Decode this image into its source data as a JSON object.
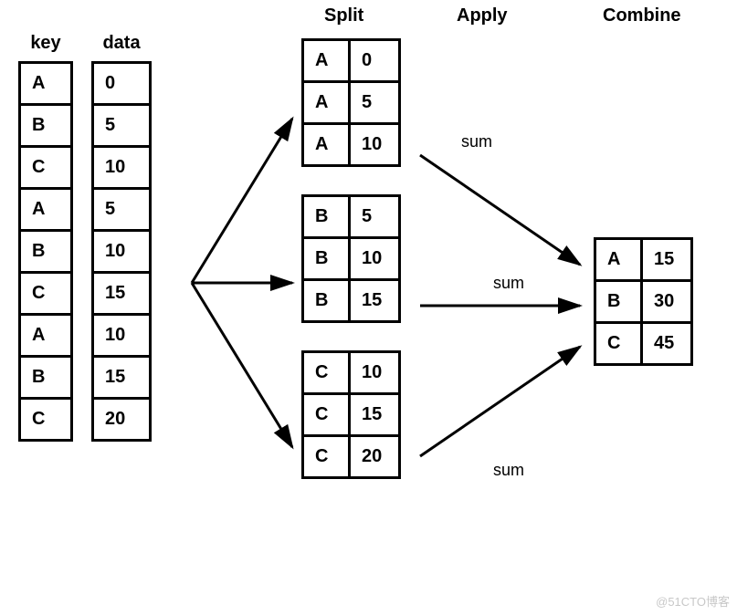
{
  "headers": {
    "key": "key",
    "data": "data",
    "split": "Split",
    "apply": "Apply",
    "combine": "Combine"
  },
  "source": {
    "keys": [
      "A",
      "B",
      "C",
      "A",
      "B",
      "C",
      "A",
      "B",
      "C"
    ],
    "data": [
      0,
      5,
      10,
      5,
      10,
      15,
      10,
      15,
      20
    ]
  },
  "split_groups": [
    {
      "key": "A",
      "rows": [
        [
          "A",
          0
        ],
        [
          "A",
          5
        ],
        [
          "A",
          10
        ]
      ]
    },
    {
      "key": "B",
      "rows": [
        [
          "B",
          5
        ],
        [
          "B",
          10
        ],
        [
          "B",
          15
        ]
      ]
    },
    {
      "key": "C",
      "rows": [
        [
          "C",
          10
        ],
        [
          "C",
          15
        ],
        [
          "C",
          20
        ]
      ]
    }
  ],
  "apply": {
    "op_label": "sum"
  },
  "combine": {
    "rows": [
      [
        "A",
        15
      ],
      [
        "B",
        30
      ],
      [
        "C",
        45
      ]
    ]
  },
  "watermark": "@51CTO博客",
  "chart_data": {
    "type": "table",
    "description": "Split-Apply-Combine (groupby sum) illustration",
    "input": [
      {
        "key": "A",
        "data": 0
      },
      {
        "key": "B",
        "data": 5
      },
      {
        "key": "C",
        "data": 10
      },
      {
        "key": "A",
        "data": 5
      },
      {
        "key": "B",
        "data": 10
      },
      {
        "key": "C",
        "data": 15
      },
      {
        "key": "A",
        "data": 10
      },
      {
        "key": "B",
        "data": 15
      },
      {
        "key": "C",
        "data": 20
      }
    ],
    "operation": "sum",
    "groups": {
      "A": [
        0,
        5,
        10
      ],
      "B": [
        5,
        10,
        15
      ],
      "C": [
        10,
        15,
        20
      ]
    },
    "result": [
      {
        "key": "A",
        "sum": 15
      },
      {
        "key": "B",
        "sum": 30
      },
      {
        "key": "C",
        "sum": 45
      }
    ]
  }
}
